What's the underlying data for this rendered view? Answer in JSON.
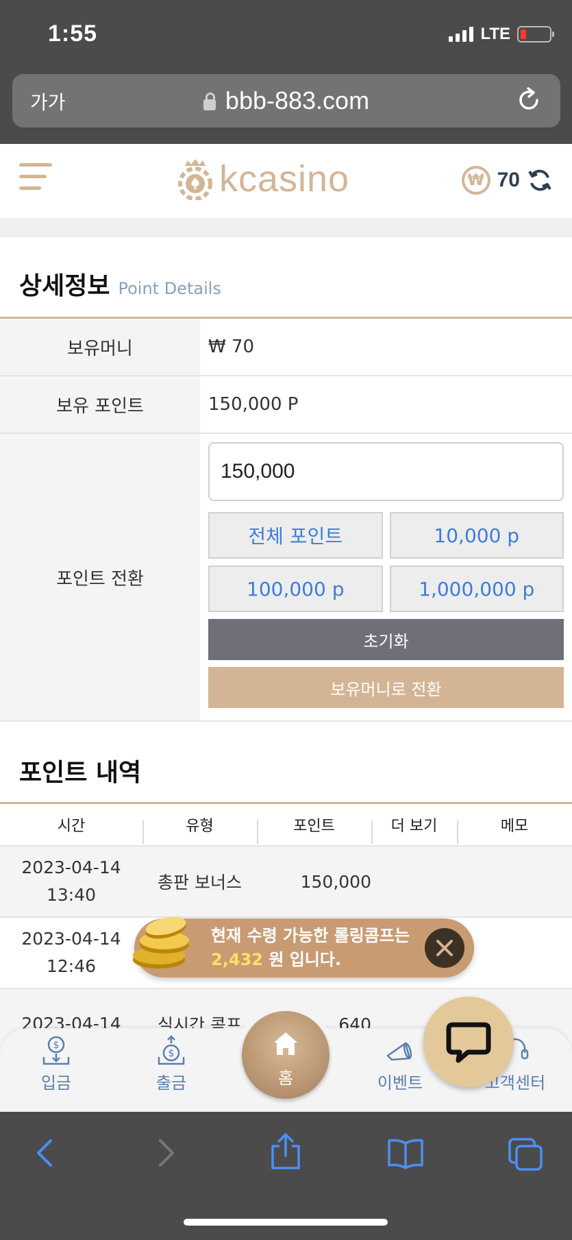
{
  "status_bar": {
    "time": "1:55",
    "network": "LTE"
  },
  "browser": {
    "text_size": "가가",
    "url": "bbb-883.com"
  },
  "header": {
    "logo_text": "kcasino",
    "balance": "70",
    "currency_symbol": "₩"
  },
  "details": {
    "title": "상세정보",
    "subtitle": "Point Details",
    "rows": [
      {
        "label": "보유머니",
        "value": "₩ 70"
      },
      {
        "label": "보유 포인트",
        "value": "150,000 P"
      }
    ],
    "convert": {
      "label": "포인트 전환",
      "input_value": "150,000",
      "quick_buttons": [
        "전체 포인트",
        "10,000 p",
        "100,000 p",
        "1,000,000 p"
      ],
      "reset_label": "초기화",
      "convert_label": "보유머니로 전환"
    }
  },
  "history": {
    "title": "포인트 내역",
    "columns": [
      "시간",
      "유형",
      "포인트",
      "더 보기",
      "메모"
    ],
    "rows": [
      {
        "date": "2023-04-14",
        "time": "13:40",
        "type": "총판 보너스",
        "points": "150,000"
      },
      {
        "date": "2023-04-14",
        "time": "12:46",
        "type": "",
        "points": ""
      },
      {
        "date": "2023-04-14",
        "time": "",
        "type": "실시간 콤프",
        "points": "640"
      }
    ]
  },
  "promo": {
    "line1": "현재 수령 가능한 롤링콤프는",
    "amount": "2,432",
    "line2_suffix": " 원 입니다."
  },
  "bottom_nav": {
    "deposit": "입금",
    "withdraw": "출금",
    "home": "홈",
    "events": "이벤트",
    "support": "고객센터"
  },
  "colors": {
    "accent": "#d3b596",
    "link_blue": "#3d7ddb",
    "nav_blue": "#5a7fb0"
  }
}
